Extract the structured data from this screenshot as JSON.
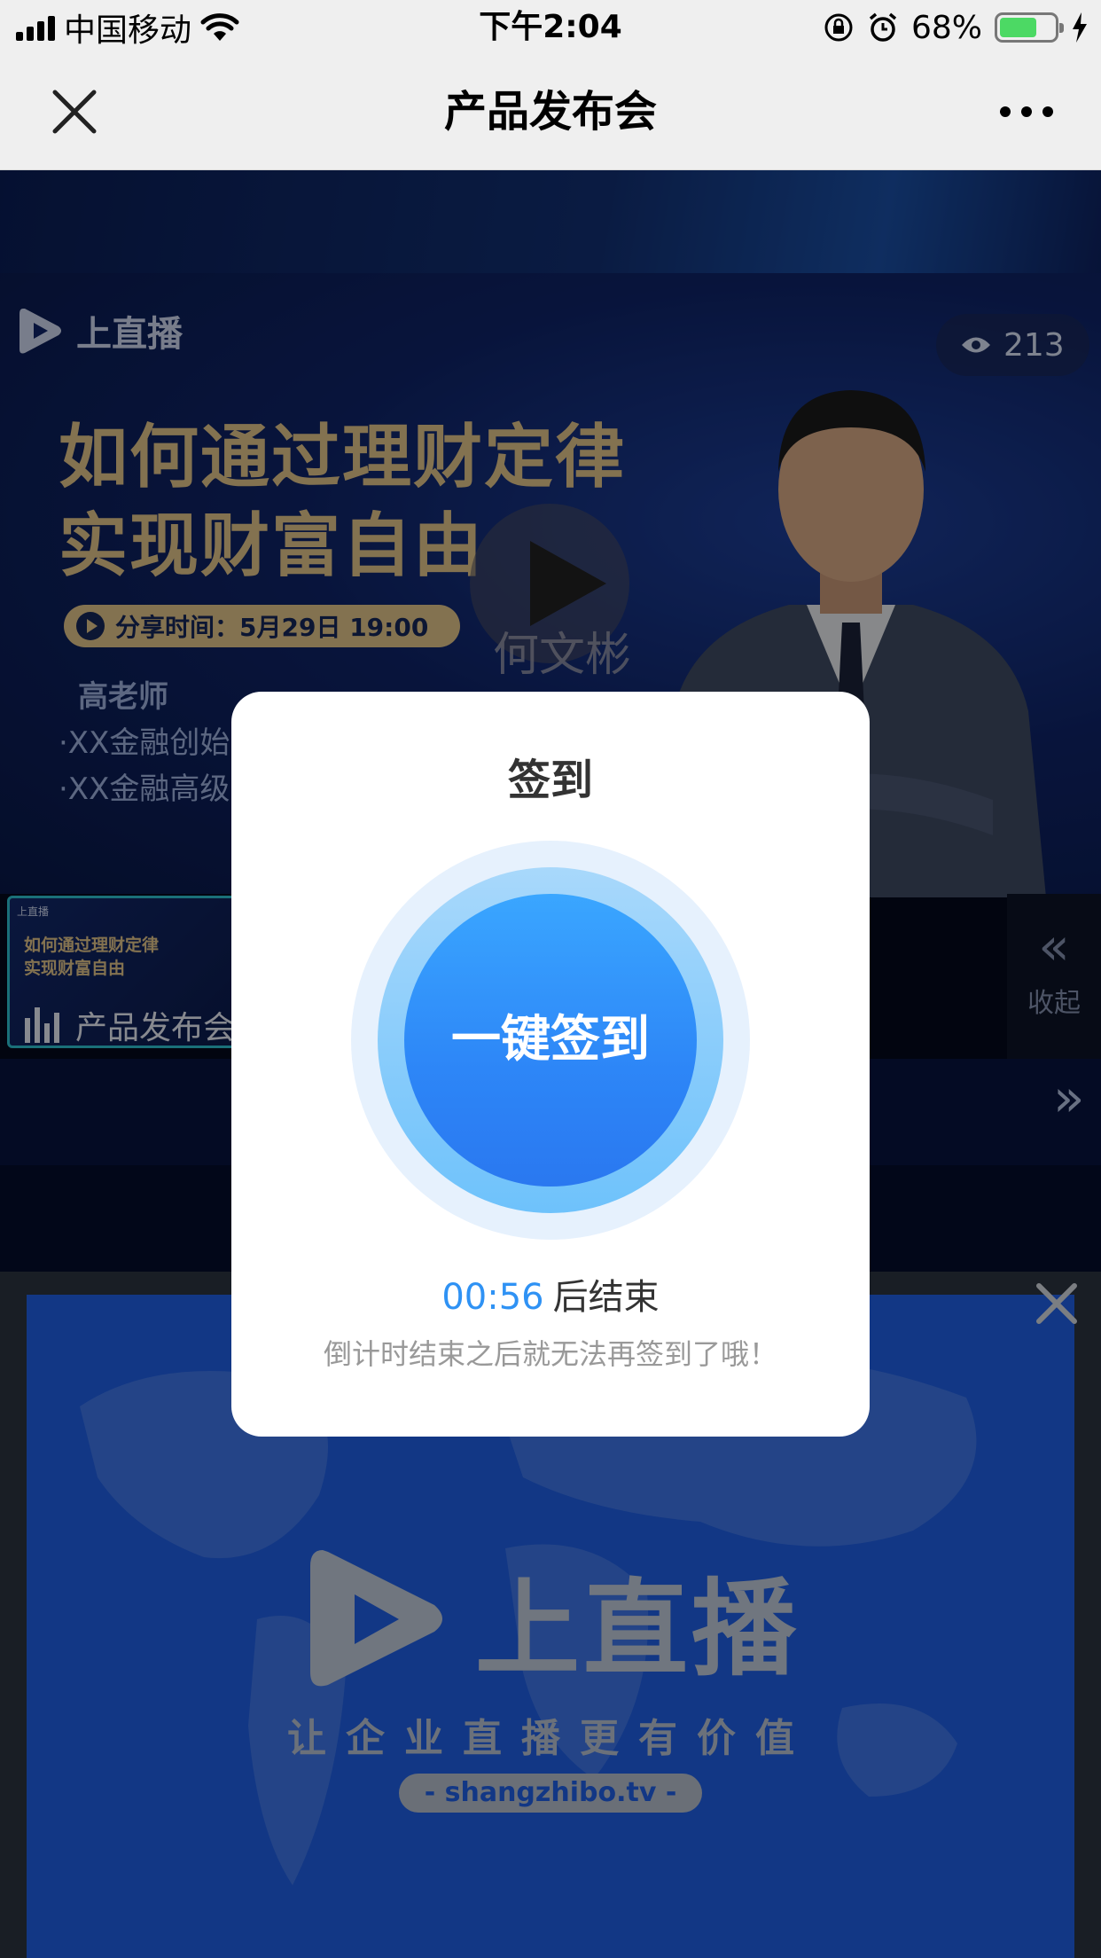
{
  "status_bar": {
    "carrier": "中国移动",
    "time": "下午2:04",
    "battery": "68%",
    "battery_level": 0.68
  },
  "nav": {
    "title": "产品发布会"
  },
  "live": {
    "brand": "上直播",
    "viewers": "213",
    "headline_line1": "如何通过理财定律",
    "headline_line2": "实现财富自由",
    "share_time": "分享时间：5月29日 19:00",
    "teacher_title": "高老师",
    "teacher_line1": "·XX金融创始",
    "teacher_line2": "·XX金融高级",
    "presenter": "何文彬",
    "thumb_title1": "如何通过理财定律",
    "thumb_title2": "实现财富自由",
    "thumb_label": "产品发布会",
    "collapse_label": "收起"
  },
  "ad": {
    "brand": "上直播",
    "slogan": "让企业直播更有价值",
    "url": "- shangzhibo.tv -"
  },
  "modal": {
    "title": "签到",
    "button": "一键签到",
    "countdown": "00:56",
    "countdown_suffix": "后结束",
    "hint": "倒计时结束之后就无法再签到了哦！"
  },
  "colors": {
    "accent_blue": "#2f92f4",
    "headline_gold": "#e2c48a",
    "battery_green": "#4cd964"
  }
}
